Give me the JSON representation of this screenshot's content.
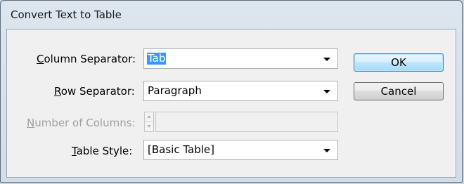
{
  "dialog": {
    "title": "Convert Text to Table"
  },
  "fields": {
    "column_separator": {
      "label_underlined": "C",
      "label_rest": "olumn Separator:",
      "value": "Tab"
    },
    "row_separator": {
      "label_underlined": "R",
      "label_rest": "ow Separator:",
      "value": "Paragraph"
    },
    "number_of_columns": {
      "label_underlined": "N",
      "label_rest": "umber of Columns:",
      "value": ""
    },
    "table_style": {
      "label_underlined": "T",
      "label_rest": "able Style:",
      "value": "[Basic Table]"
    }
  },
  "buttons": {
    "ok_label": "OK",
    "cancel_label": "Cancel"
  },
  "icons": {
    "dropdown": "chevron-down-icon",
    "spinner_up": "spin-up-icon",
    "spinner_down": "spin-down-icon"
  }
}
